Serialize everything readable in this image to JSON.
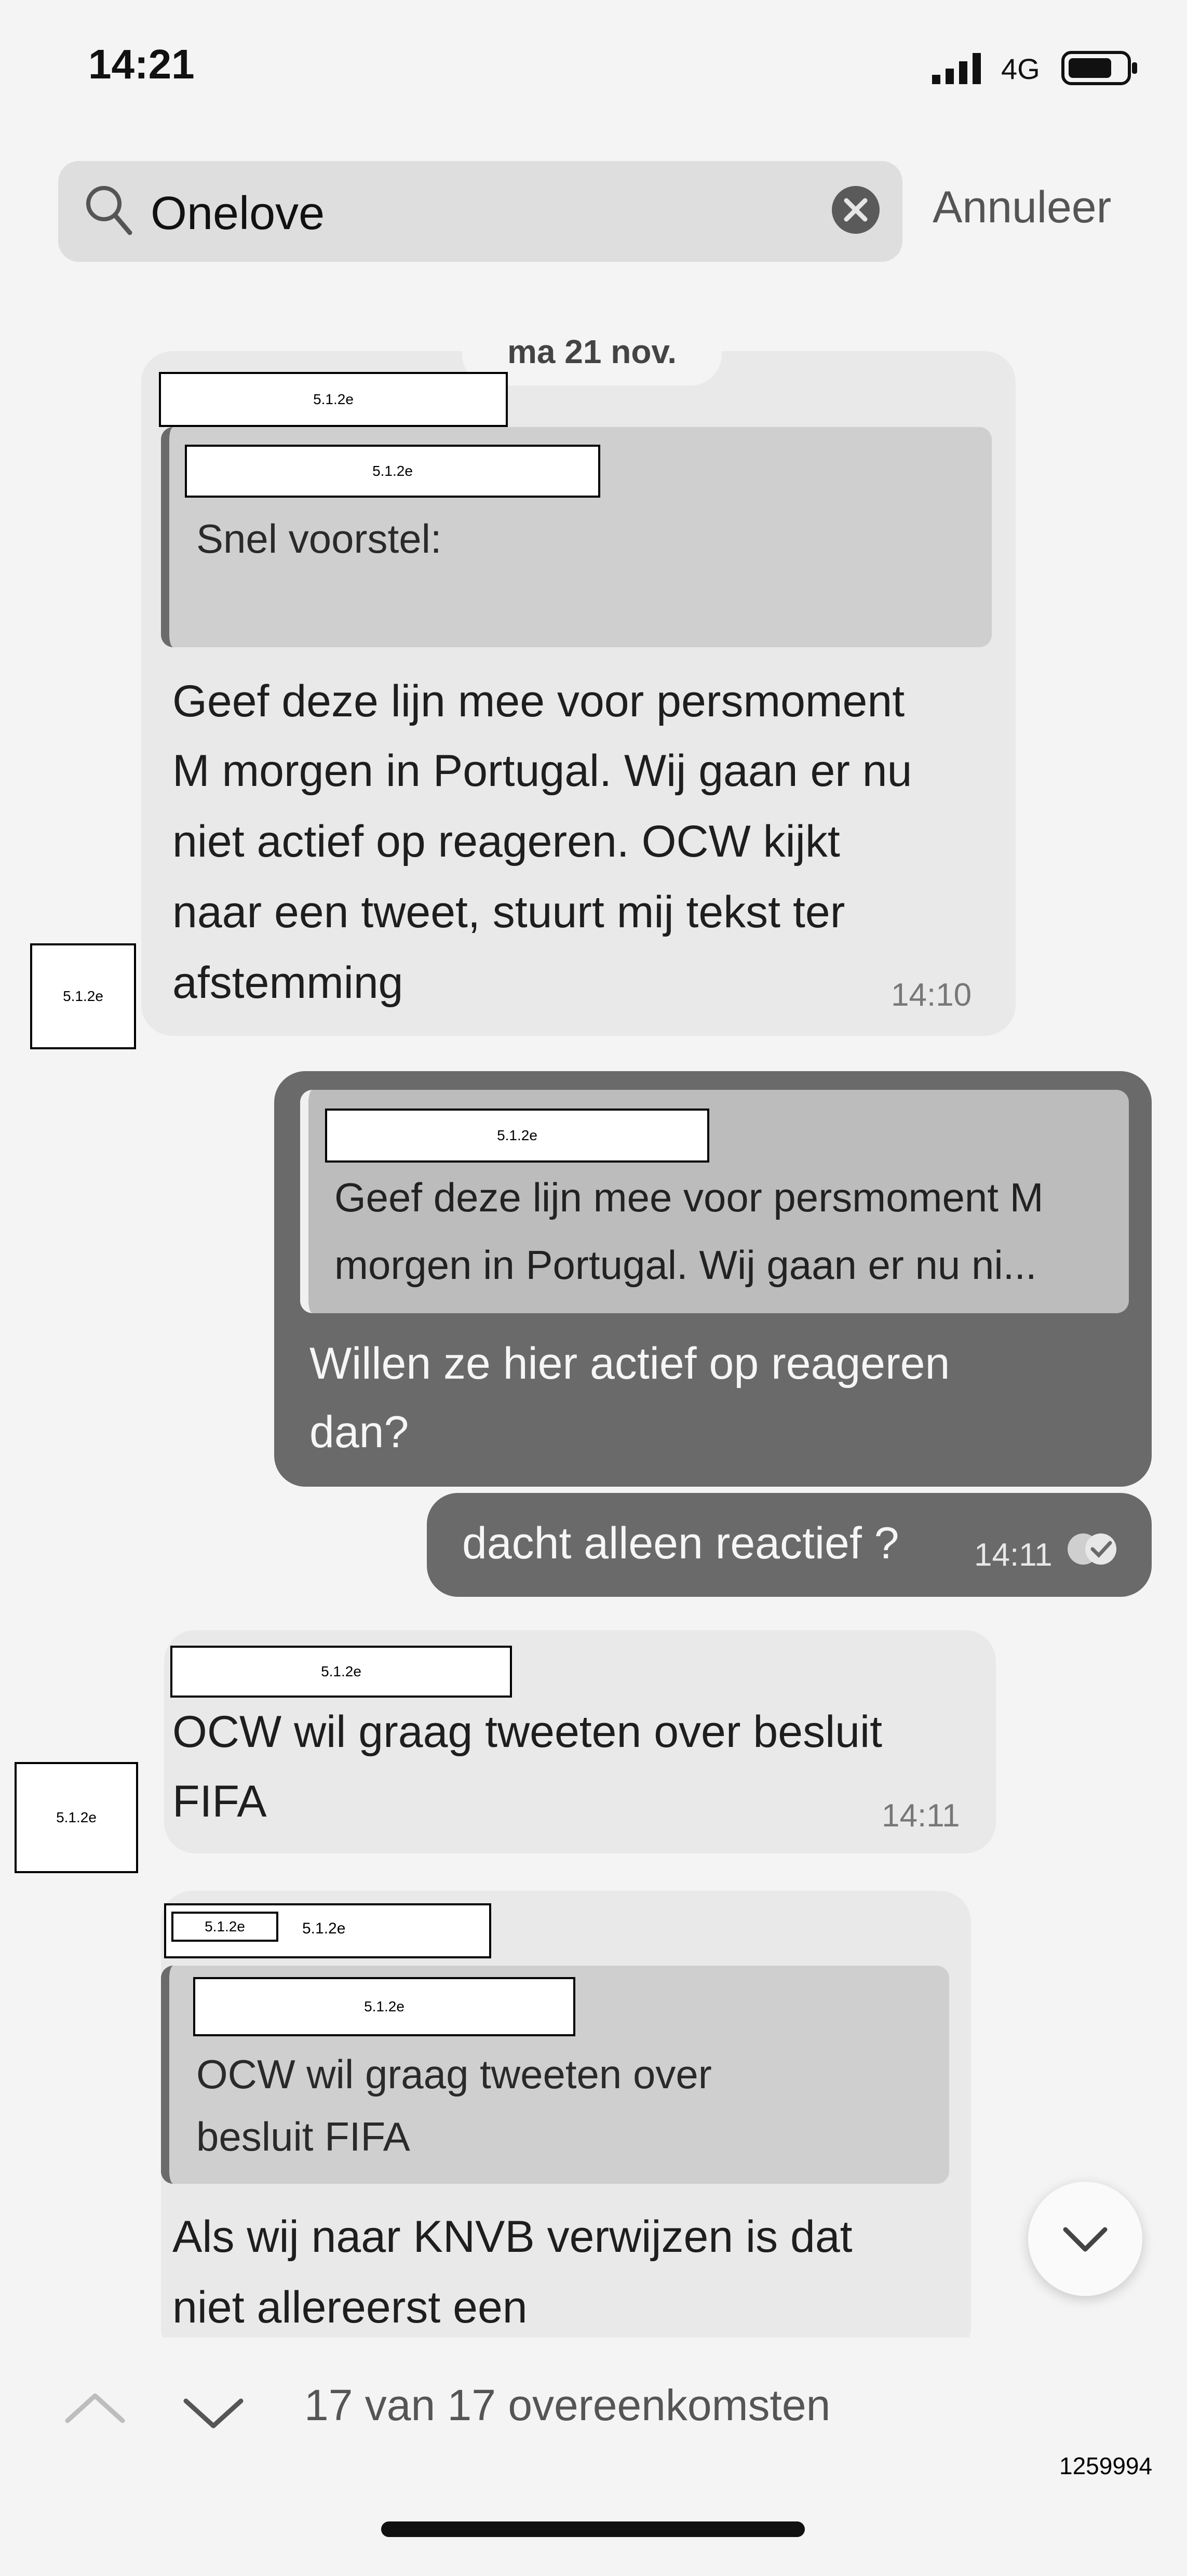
{
  "status_bar": {
    "time": "14:21",
    "network": "4G"
  },
  "search": {
    "query": "Onelove",
    "cancel_label": "Annuleer"
  },
  "date_separator": "ma 21 nov.",
  "redaction_code": "5.1.2e",
  "messages": [
    {
      "direction": "incoming",
      "quote_text": "Snel voorstel:",
      "text_lines": [
        "Geef deze lijn mee voor persmoment",
        "M morgen in Portugal. Wij gaan er nu",
        "niet actief op reageren. OCW kijkt",
        "naar een tweet, stuurt mij tekst ter",
        "afstemming"
      ],
      "time": "14:10"
    },
    {
      "direction": "outgoing",
      "quote_lines": [
        "Geef deze lijn mee voor persmoment M",
        "morgen in Portugal. Wij gaan er nu ni..."
      ],
      "text_lines": [
        "Willen ze hier actief op reageren",
        "dan?"
      ]
    },
    {
      "direction": "outgoing",
      "text": "dacht alleen reactief ?",
      "time": "14:11"
    },
    {
      "direction": "incoming",
      "text_lines": [
        "OCW wil graag tweeten over besluit",
        "FIFA"
      ],
      "time": "14:11"
    },
    {
      "direction": "incoming",
      "quote_lines": [
        "OCW wil graag tweeten over",
        "besluit FIFA"
      ],
      "text_lines": [
        "Als wij naar KNVB verwijzen is dat",
        "niet allereerst een"
      ]
    }
  ],
  "search_nav": {
    "match_count": "17 van 17 overeenkomsten"
  },
  "document_number": "1259994",
  "icons": [
    "search-icon",
    "clear-icon",
    "signal-icon",
    "battery-icon",
    "read-receipt-icon",
    "chevron-down-icon",
    "chevron-up-icon"
  ]
}
